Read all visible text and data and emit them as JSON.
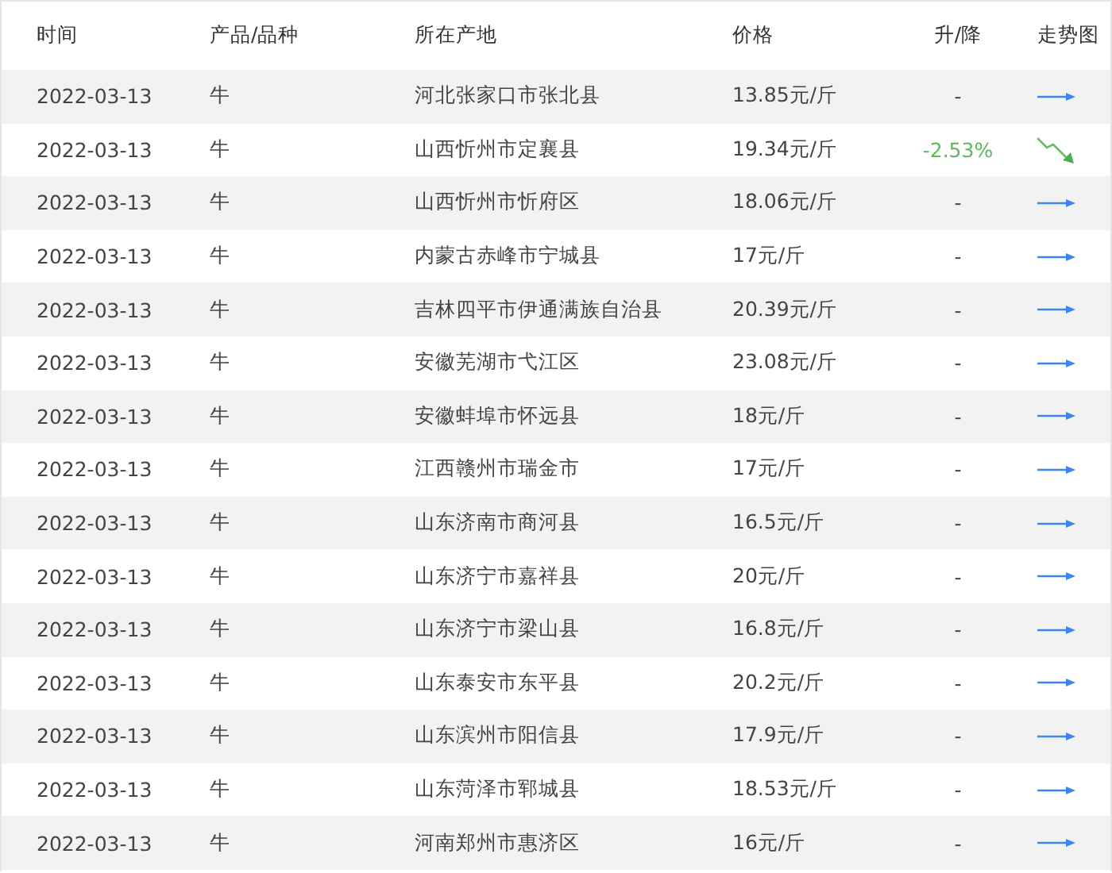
{
  "columns": [
    "时间",
    "产品/品种",
    "所在产地",
    "价格",
    "升/降",
    "走势图"
  ],
  "rows": [
    {
      "date": "2022-03-13",
      "product": "牛",
      "origin": "河北张家口市张北县",
      "price": "13.85元/斤",
      "change": "-",
      "kind": "flat"
    },
    {
      "date": "2022-03-13",
      "product": "牛",
      "origin": "山西忻州市定襄县",
      "price": "19.34元/斤",
      "change": "-2.53%",
      "kind": "down"
    },
    {
      "date": "2022-03-13",
      "product": "牛",
      "origin": "山西忻州市忻府区",
      "price": "18.06元/斤",
      "change": "-",
      "kind": "flat"
    },
    {
      "date": "2022-03-13",
      "product": "牛",
      "origin": "内蒙古赤峰市宁城县",
      "price": "17元/斤",
      "change": "-",
      "kind": "flat"
    },
    {
      "date": "2022-03-13",
      "product": "牛",
      "origin": "吉林四平市伊通满族自治县",
      "price": "20.39元/斤",
      "change": "-",
      "kind": "flat"
    },
    {
      "date": "2022-03-13",
      "product": "牛",
      "origin": "安徽芜湖市弋江区",
      "price": "23.08元/斤",
      "change": "-",
      "kind": "flat"
    },
    {
      "date": "2022-03-13",
      "product": "牛",
      "origin": "安徽蚌埠市怀远县",
      "price": "18元/斤",
      "change": "-",
      "kind": "flat"
    },
    {
      "date": "2022-03-13",
      "product": "牛",
      "origin": "江西赣州市瑞金市",
      "price": "17元/斤",
      "change": "-",
      "kind": "flat"
    },
    {
      "date": "2022-03-13",
      "product": "牛",
      "origin": "山东济南市商河县",
      "price": "16.5元/斤",
      "change": "-",
      "kind": "flat"
    },
    {
      "date": "2022-03-13",
      "product": "牛",
      "origin": "山东济宁市嘉祥县",
      "price": "20元/斤",
      "change": "-",
      "kind": "flat"
    },
    {
      "date": "2022-03-13",
      "product": "牛",
      "origin": "山东济宁市梁山县",
      "price": "16.8元/斤",
      "change": "-",
      "kind": "flat"
    },
    {
      "date": "2022-03-13",
      "product": "牛",
      "origin": "山东泰安市东平县",
      "price": "20.2元/斤",
      "change": "-",
      "kind": "flat"
    },
    {
      "date": "2022-03-13",
      "product": "牛",
      "origin": "山东滨州市阳信县",
      "price": "17.9元/斤",
      "change": "-",
      "kind": "flat"
    },
    {
      "date": "2022-03-13",
      "product": "牛",
      "origin": "山东菏泽市郓城县",
      "price": "18.53元/斤",
      "change": "-",
      "kind": "flat"
    },
    {
      "date": "2022-03-13",
      "product": "牛",
      "origin": "河南郑州市惠济区",
      "price": "16元/斤",
      "change": "-",
      "kind": "flat"
    }
  ]
}
